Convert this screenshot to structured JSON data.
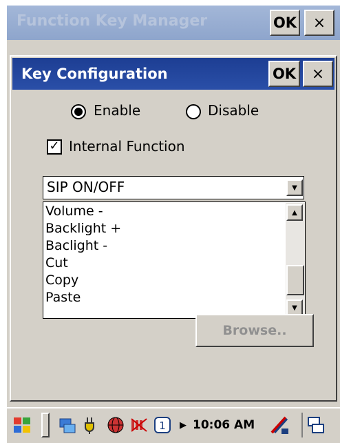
{
  "outer_window": {
    "title": "Function Key Manager",
    "ok_label": "OK",
    "close_label": "×"
  },
  "dialog": {
    "title": "Key Configuration",
    "ok_label": "OK",
    "close_label": "×",
    "radio_enable_label": "Enable",
    "radio_disable_label": "Disable",
    "selected_radio": "Enable",
    "checkbox_label": "Internal Function",
    "checkbox_checked": true,
    "combo_value": "SIP ON/OFF",
    "list_items": [
      "Volume -",
      "Backlight +",
      "Baclight -",
      "Cut",
      "Copy",
      "Paste"
    ],
    "browse_label": "Browse.."
  },
  "taskbar": {
    "time": "10:06 AM",
    "icons": [
      "start-flag-icon",
      "keyboard-divider-icon",
      "network-icon",
      "power-plug-icon",
      "globe-icon",
      "signal-off-icon",
      "input-1-icon",
      "arrow-right-icon",
      "sip-pen-icon",
      "task-switch-icon"
    ]
  }
}
